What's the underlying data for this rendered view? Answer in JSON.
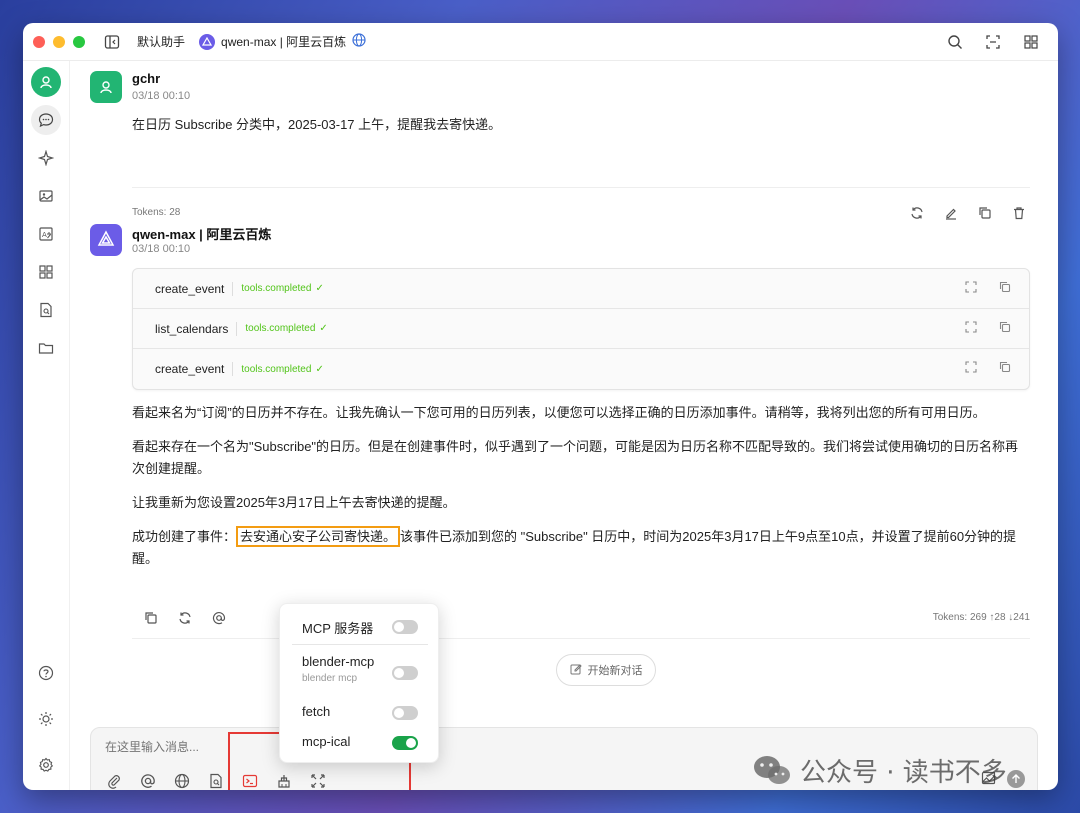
{
  "titlebar": {
    "assistant": "默认助手",
    "model": "qwen-max | 阿里云百炼"
  },
  "messages": {
    "user": {
      "name": "gchr",
      "time": "03/18 00:10",
      "text": "在日历 Subscribe 分类中，2025-03-17 上午，提醒我去寄快递。",
      "tokens": "Tokens: 28"
    },
    "ai": {
      "name": "qwen-max | 阿里云百炼",
      "time": "03/18 00:10",
      "tools": [
        {
          "name": "create_event",
          "status": "tools.completed"
        },
        {
          "name": "list_calendars",
          "status": "tools.completed"
        },
        {
          "name": "create_event",
          "status": "tools.completed"
        }
      ],
      "para1": "看起来名为“订阅”的日历并不存在。让我先确认一下您可用的日历列表，以便您可以选择正确的日历添加事件。请稍等，我将列出您的所有可用日历。",
      "para2": "看起来存在一个名为\"Subscribe\"的日历。但是在创建事件时，似乎遇到了一个问题，可能是因为日历名称不匹配导致的。我们将尝试使用确切的日历名称再次创建提醒。",
      "para3": "让我重新为您设置2025年3月17日上午去寄快递的提醒。",
      "para4_prefix": "成功创建了事件：",
      "para4_highlight": "去安通心安子公司寄快递。",
      "para4_suffix": "该事件已添加到您的 \"Subscribe\" 日历中，时间为2025年3月17日上午9点至10点，并设置了提前60分钟的提醒。",
      "tokens": "Tokens: 269 ↑28 ↓241"
    }
  },
  "new_chat": "开始新对话",
  "input": {
    "placeholder": "在这里输入消息..."
  },
  "mcp_popup": {
    "header": "MCP 服务器",
    "header_on": false,
    "items": [
      {
        "label": "blender-mcp",
        "sub": "blender mcp",
        "on": false
      },
      {
        "label": "fetch",
        "on": false
      },
      {
        "label": "mcp-ical",
        "on": true
      }
    ]
  },
  "watermark": "公众号 · 读书不多"
}
